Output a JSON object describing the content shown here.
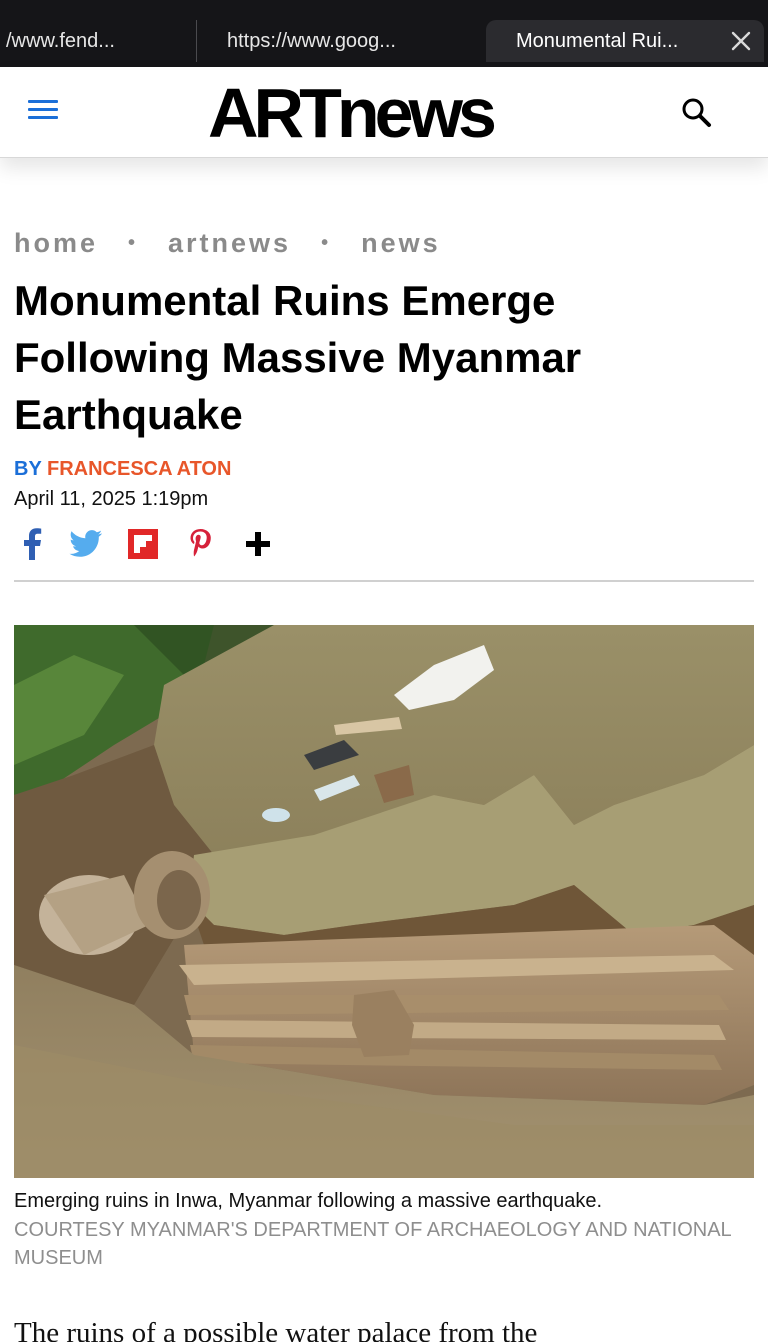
{
  "browser": {
    "tabs": [
      {
        "title": "/www.fend..."
      },
      {
        "title": "https://www.goog..."
      },
      {
        "title": "Monumental Rui..."
      }
    ],
    "close_icon": "close-icon"
  },
  "header": {
    "logo_text": "ARTnews",
    "menu_icon": "hamburger-icon",
    "search_icon": "search-icon",
    "accent_color": "#1b6fd8"
  },
  "article": {
    "breadcrumb": [
      "home",
      "artnews",
      "news"
    ],
    "breadcrumb_separator": "•",
    "headline": "Monumental Ruins Emerge Following Massive Myanmar Earthquake",
    "byline_prefix": "BY",
    "author": "FRANCESCA ATON",
    "date": "April 11, 2025 1:19pm",
    "share_icons": [
      "facebook-icon",
      "twitter-icon",
      "flipboard-icon",
      "pinterest-icon",
      "plus-icon"
    ],
    "image_caption": "Emerging ruins in Inwa, Myanmar following a massive earthquake.",
    "image_credit": "COURTESY MYANMAR'S DEPARTMENT OF ARCHAEOLOGY AND NATIONAL MUSEUM",
    "body_first_line": "The ruins of a possible water palace from the"
  }
}
